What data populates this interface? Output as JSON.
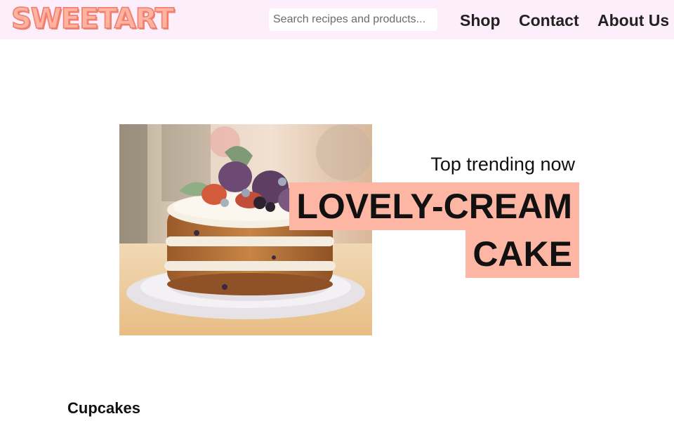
{
  "header": {
    "logo_text": "SWEETART",
    "search_placeholder": "Search recipes and products...",
    "nav": [
      "Shop",
      "Contact",
      "About Us"
    ]
  },
  "hero": {
    "kicker": "Top trending now",
    "title_line_1": "LOVELY-CREAM",
    "title_line_2": "CAKE",
    "image_subject": "naked-cake-with-figs-image",
    "highlight_color": "#fdb5a4"
  },
  "section": {
    "title": "Cupcakes"
  },
  "colors": {
    "header_bg": "#fdeefb",
    "logo_fill": "#ffb3a0",
    "logo_outline": "#f07f6e"
  }
}
